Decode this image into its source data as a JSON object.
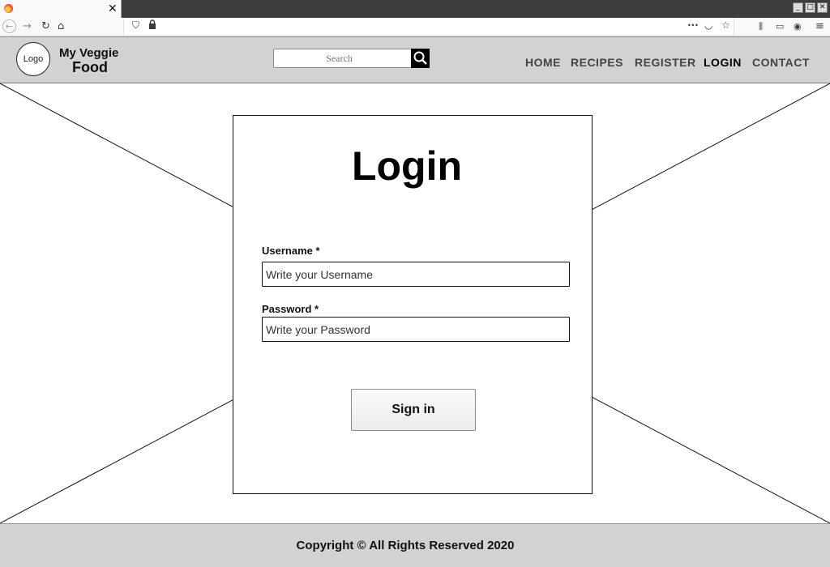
{
  "browser": {
    "tab_close": "✕",
    "window_controls": [
      "_",
      "□",
      "✕"
    ],
    "nav_icons": [
      "back-icon",
      "forward-icon",
      "reload-icon",
      "home-icon"
    ],
    "url_icons": [
      "shield-icon",
      "lock-icon"
    ],
    "toolbar_icons": [
      "more-icon",
      "pocket-icon",
      "bookmark-star-icon",
      "library-icon",
      "sidebar-icon",
      "account-icon",
      "menu-icon"
    ]
  },
  "header": {
    "logo_text": "Logo",
    "brand_line1": "My Veggie",
    "brand_line2": "Food",
    "search_placeholder": "Search",
    "nav": [
      {
        "label": "HOME",
        "active": false
      },
      {
        "label": "RECIPES",
        "active": false
      },
      {
        "label": "REGISTER",
        "active": false
      },
      {
        "label": "LOGIN",
        "active": true
      },
      {
        "label": "CONTACT",
        "active": false
      }
    ]
  },
  "login": {
    "title": "Login",
    "username_label": "Username *",
    "username_placeholder": "Write your Username",
    "password_label": "Password *",
    "password_placeholder": "Write your Password",
    "submit_label": "Sign in"
  },
  "footer": {
    "text": "Copyright © All Rights Reserved 2020"
  },
  "colors": {
    "header_bg": "#d2d2d2",
    "footer_bg": "#d2d2d2",
    "nav_text": "#444444",
    "nav_active": "#000000"
  }
}
